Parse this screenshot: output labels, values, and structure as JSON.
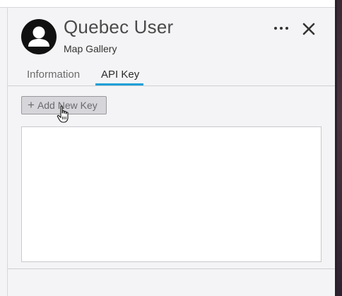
{
  "profile": {
    "name": "Quebec User",
    "subtitle": "Map Gallery",
    "avatar_icon": "person-icon"
  },
  "header_actions": {
    "more_icon": "ellipsis-icon",
    "more_glyph": "⋯",
    "close_icon": "close-icon",
    "close_glyph": "✕"
  },
  "tabs": [
    {
      "label": "Information",
      "active": false
    },
    {
      "label": "API Key",
      "active": true
    }
  ],
  "api_key": {
    "add_button": {
      "plus_glyph": "+",
      "label": "Add New Key"
    },
    "keys": []
  },
  "colors": {
    "accent_tab_underline": "#1aa0d8",
    "avatar_bg": "#111111",
    "panel_bg": "#f4f4f6"
  }
}
